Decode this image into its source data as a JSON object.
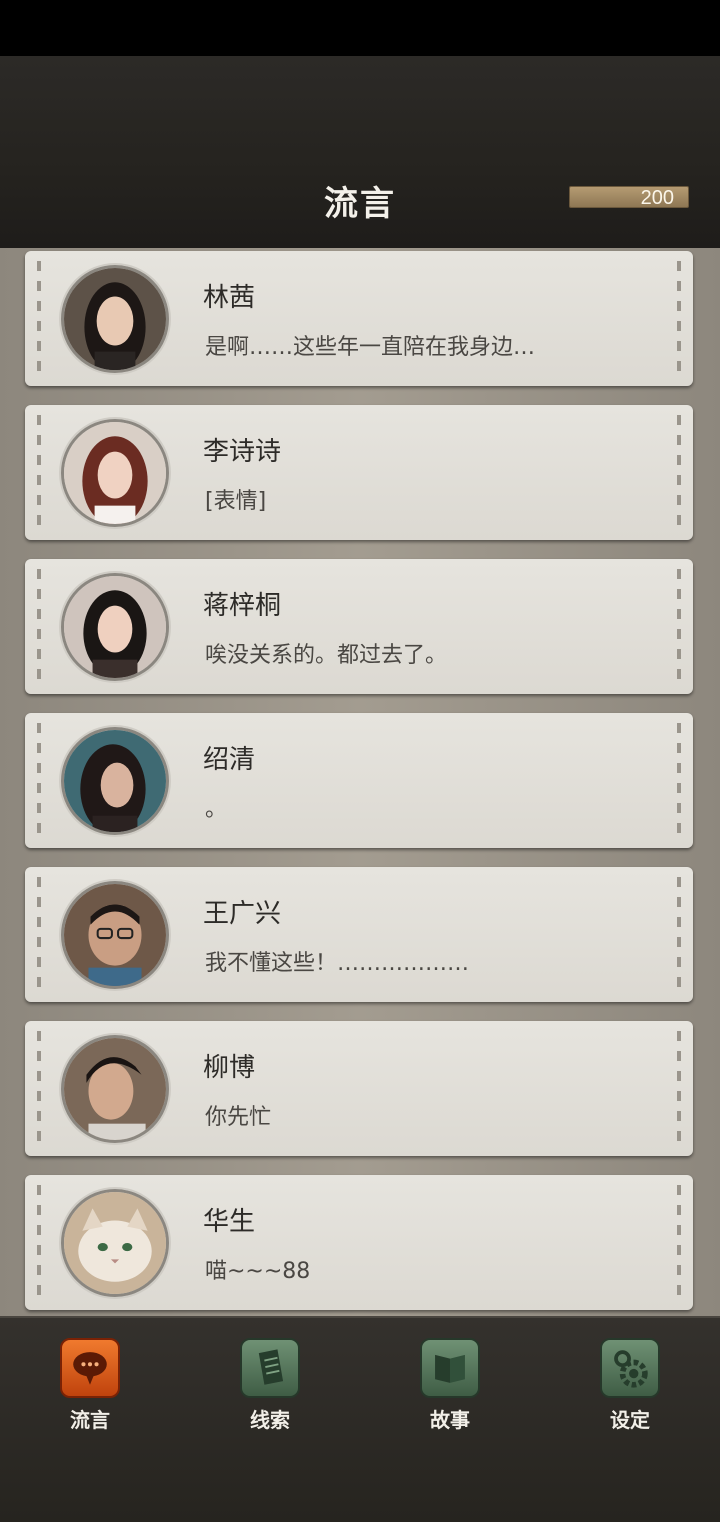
{
  "header": {
    "title": "流言",
    "coins": "200"
  },
  "contacts": [
    {
      "name": "林茜",
      "message": "是啊……这些年一直陪在我身边…",
      "avatar": "woman-avatar"
    },
    {
      "name": "李诗诗",
      "message": "[表情]",
      "avatar": "woman-avatar"
    },
    {
      "name": "蒋梓桐",
      "message": "唉没关系的。都过去了。",
      "avatar": "woman-avatar"
    },
    {
      "name": "绍清",
      "message": "。",
      "avatar": "woman-avatar"
    },
    {
      "name": "王广兴",
      "message": "我不懂这些！………………",
      "avatar": "man-avatar"
    },
    {
      "name": "柳博",
      "message": "你先忙",
      "avatar": "man-avatar"
    },
    {
      "name": "华生",
      "message": "喵~~~88",
      "avatar": "cat-avatar"
    }
  ],
  "nav": [
    {
      "label": "流言",
      "icon": "chat-bubble-icon",
      "active": true
    },
    {
      "label": "线索",
      "icon": "notes-icon",
      "active": false
    },
    {
      "label": "故事",
      "icon": "book-icon",
      "active": false
    },
    {
      "label": "设定",
      "icon": "gear-icon",
      "active": false
    }
  ]
}
